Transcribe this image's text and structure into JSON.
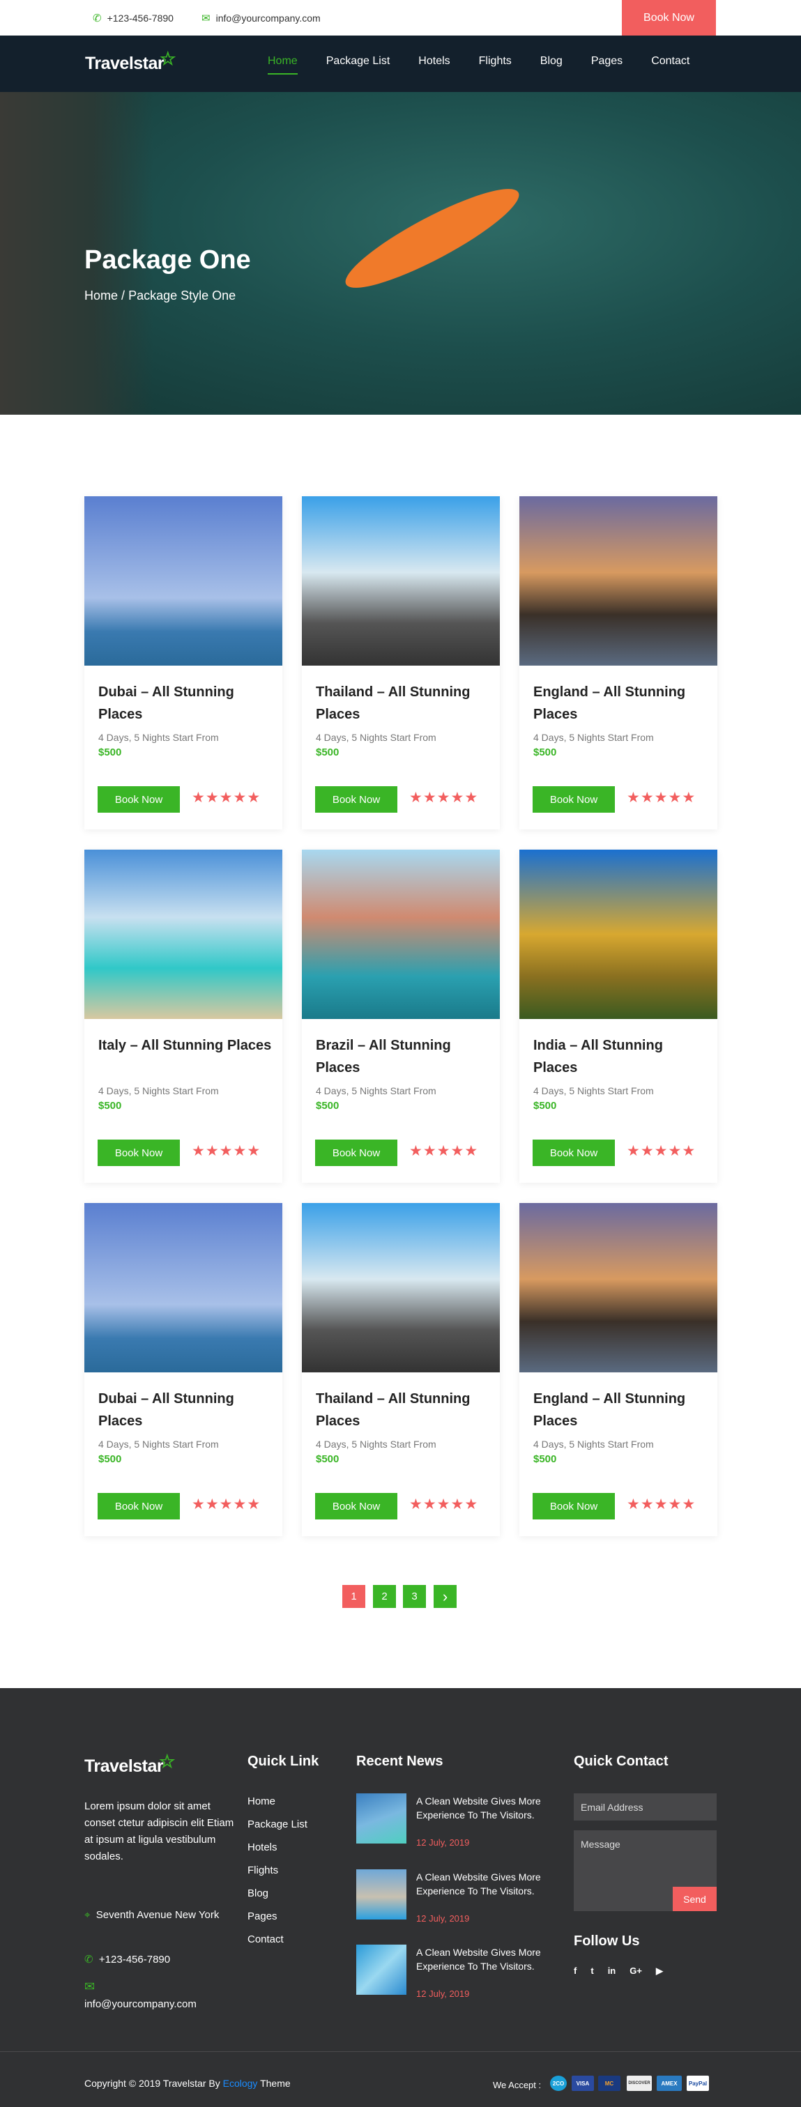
{
  "topbar": {
    "phone": "+123-456-7890",
    "email": "info@yourcompany.com",
    "book_now": "Book Now"
  },
  "brand": {
    "name": "Travelstar",
    "accent": "#3ab526",
    "coral": "#f25e5e"
  },
  "nav": {
    "items": [
      "Home",
      "Package List",
      "Hotels",
      "Flights",
      "Blog",
      "Pages",
      "Contact"
    ],
    "active": "Home"
  },
  "hero": {
    "title": "Package One",
    "breadcrumb_home": "Home",
    "breadcrumb_sep": "/",
    "breadcrumb_current": "Package Style One"
  },
  "packages": [
    {
      "title": "Dubai – All Stunning Places",
      "sub": "4 Days, 5 Nights Start From",
      "price": "$500",
      "button": "Book Now",
      "rating": 5
    },
    {
      "title": "Thailand – All Stunning Places",
      "sub": "4 Days, 5 Nights Start From",
      "price": "$500",
      "button": "Book Now",
      "rating": 5
    },
    {
      "title": "England – All Stunning Places",
      "sub": "4 Days, 5 Nights Start From",
      "price": "$500",
      "button": "Book Now",
      "rating": 5
    },
    {
      "title": "Italy – All Stunning Places",
      "sub": "4 Days, 5 Nights Start From",
      "price": "$500",
      "button": "Book Now",
      "rating": 5
    },
    {
      "title": "Brazil – All Stunning Places",
      "sub": "4 Days, 5 Nights Start From",
      "price": "$500",
      "button": "Book Now",
      "rating": 5
    },
    {
      "title": "India – All Stunning Places",
      "sub": "4 Days, 5 Nights Start From",
      "price": "$500",
      "button": "Book Now",
      "rating": 5
    },
    {
      "title": "Dubai – All Stunning Places",
      "sub": "4 Days, 5 Nights Start From",
      "price": "$500",
      "button": "Book Now",
      "rating": 5
    },
    {
      "title": "Thailand – All Stunning Places",
      "sub": "4 Days, 5 Nights Start From",
      "price": "$500",
      "button": "Book Now",
      "rating": 5
    },
    {
      "title": "England – All Stunning Places",
      "sub": "4 Days, 5 Nights Start From",
      "price": "$500",
      "button": "Book Now",
      "rating": 5
    }
  ],
  "pagination": {
    "pages": [
      "1",
      "2",
      "3"
    ],
    "current": "1",
    "next": "›"
  },
  "footer": {
    "about": "Lorem ipsum dolor sit amet conset ctetur adipiscin elit Etiam at ipsum at ligula vestibulum sodales.",
    "address": "Seventh Avenue New York",
    "phone": "+123-456-7890",
    "email": "info@yourcompany.com",
    "quick_link_title": "Quick Link",
    "quick_links": [
      "Home",
      "Package List",
      "Hotels",
      "Flights",
      "Blog",
      "Pages",
      "Contact"
    ],
    "news_title": "Recent News",
    "news": [
      {
        "title": "A Clean Website Gives More Experience To The Visitors.",
        "date": "12 July, 2019"
      },
      {
        "title": "A Clean Website Gives More Experience To The Visitors.",
        "date": "12 July, 2019"
      },
      {
        "title": "A Clean Website Gives More Experience To The Visitors.",
        "date": "12 July, 2019"
      }
    ],
    "contact_title": "Quick Contact",
    "email_placeholder": "Email Address",
    "message_placeholder": "Message",
    "send": "Send",
    "follow_title": "Follow Us",
    "social": [
      "f",
      "t",
      "in",
      "G+",
      "▶"
    ],
    "copyright_pre": "Copyright © 2019 Travelstar By ",
    "copyright_link": "Ecology",
    "copyright_post": " Theme",
    "we_accept": "We Accept :",
    "payments": [
      "2CO",
      "VISA",
      "MC",
      "DISCOVER",
      "AMEX",
      "PayPal"
    ]
  }
}
